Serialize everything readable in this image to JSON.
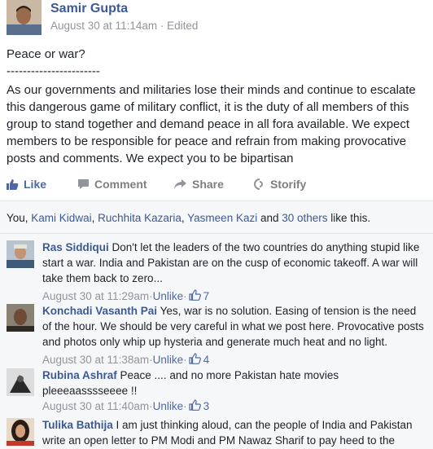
{
  "post": {
    "author": "Samir Gupta",
    "timestamp": "August 30 at 11:14am",
    "separator": " · ",
    "edited": "Edited",
    "title": "Peace or war?",
    "divider": "-----------------------",
    "body": "As our governments and militaries lose their minds and continue to escalate this dangerous game of military conflict, it is the duty of all members of this group to stand together and demand peace in all fora available. We expect members to be responsible for peace and refrain from making provocative posts and comments. We expect you to be bipartisan"
  },
  "actions": {
    "like": "Like",
    "comment": "Comment",
    "share": "Share",
    "storify": "Storify"
  },
  "likes": {
    "prefix": "You, ",
    "names": [
      "Kami Kidwai",
      "Ruchhita Kazaria",
      "Yasmeen Kazi"
    ],
    "sep1": ", ",
    "sep2": ", ",
    "and": " and ",
    "others": "30 others",
    "suffix": " like this."
  },
  "comments": [
    {
      "author": "Ras Siddiqui",
      "text": "Don't let the leaders of the two countries do anything stupid like start a war. India and Pakistan are on the cusp of economic takeoff. A war will take them back to zero...",
      "timestamp": "August 30 at 11:29am",
      "action": "Unlike",
      "likes": "7"
    },
    {
      "author": "Konchadi Vasanth Pai",
      "text": "Yes, war is no solution. Easing of tension is the need of the hour. We should be very careful in what we post here. Provocative posts and photos only whip up hysteria and generate much heat and no light.",
      "timestamp": "August 30 at 11:38am",
      "action": "Unlike",
      "likes": "4"
    },
    {
      "author": "Rubina Ashraf",
      "text": "Peace .... and no more Pakistan hate movies pleeeaasssseeee !!",
      "timestamp": "August 30 at 11:40am",
      "action": "Unlike",
      "likes": "3"
    },
    {
      "author": "Tulika Bathija",
      "text": "I am just thinking aloud, can the people of India and Pakistan write an open letter to PM Modi and PM Nawaz Sharif to pay heed to the"
    }
  ],
  "meta_separator": " · ",
  "colors": {
    "link": "#3b5998",
    "like_blue": "#4e69a2",
    "meta_gray": "#90949c",
    "bar_bg": "#f6f7f9"
  }
}
